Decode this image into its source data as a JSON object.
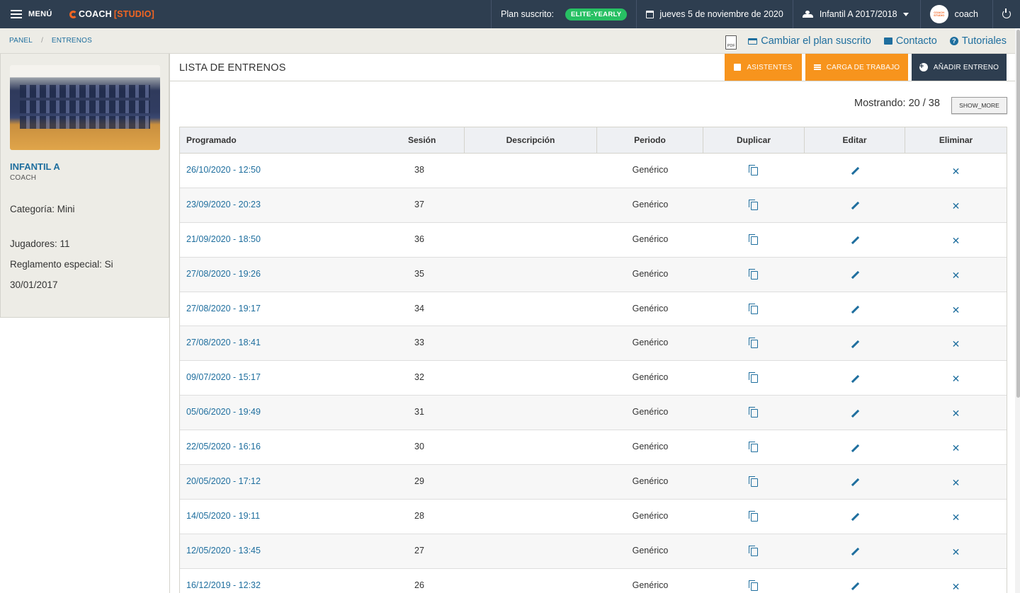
{
  "topbar": {
    "menu_label": "MENÚ",
    "logo_text": "COACH",
    "logo_studio": "[STUDIO]",
    "plan_label": "Plan suscrito:",
    "plan_badge": "ELITE-YEARLY",
    "date": "jueves 5 de noviembre de 2020",
    "team_selector": "Infantil A 2017/2018",
    "user_name": "coach",
    "avatar_text": "COACH STUDIO"
  },
  "breadcrumb": {
    "items": [
      "PANEL",
      "ENTRENOS"
    ],
    "separator": "/"
  },
  "crumb_actions": {
    "pdf_label": "PDF",
    "change_plan": "Cambiar el plan suscrito",
    "contact": "Contacto",
    "tutorials": "Tutoriales"
  },
  "sidebar": {
    "team_name": "INFANTIL A",
    "role": "COACH",
    "category": "Categoría: Mini",
    "players": "Jugadores: 11",
    "special_rules": "Reglamento especial: Si",
    "date": "30/01/2017"
  },
  "panel": {
    "title": "LISTA DE ENTRENOS",
    "btn_attendees": "ASISTENTES",
    "btn_workload": "CARGA DE TRABAJO",
    "btn_add": "AÑADIR ENTRENO",
    "showing": "Mostrando: 20 / 38",
    "show_more": "SHOW_MORE"
  },
  "table": {
    "headers": [
      "Programado",
      "Sesión",
      "Descripción",
      "Periodo",
      "Duplicar",
      "Editar",
      "Eliminar"
    ],
    "rows": [
      {
        "date": "26/10/2020 - 12:50",
        "session": "38",
        "description": "",
        "period": "Genérico"
      },
      {
        "date": "23/09/2020 - 20:23",
        "session": "37",
        "description": "",
        "period": "Genérico"
      },
      {
        "date": "21/09/2020 - 18:50",
        "session": "36",
        "description": "",
        "period": "Genérico"
      },
      {
        "date": "27/08/2020 - 19:26",
        "session": "35",
        "description": "",
        "period": "Genérico"
      },
      {
        "date": "27/08/2020 - 19:17",
        "session": "34",
        "description": "",
        "period": "Genérico"
      },
      {
        "date": "27/08/2020 - 18:41",
        "session": "33",
        "description": "",
        "period": "Genérico"
      },
      {
        "date": "09/07/2020 - 15:17",
        "session": "32",
        "description": "",
        "period": "Genérico"
      },
      {
        "date": "05/06/2020 - 19:49",
        "session": "31",
        "description": "",
        "period": "Genérico"
      },
      {
        "date": "22/05/2020 - 16:16",
        "session": "30",
        "description": "",
        "period": "Genérico"
      },
      {
        "date": "20/05/2020 - 17:12",
        "session": "29",
        "description": "",
        "period": "Genérico"
      },
      {
        "date": "14/05/2020 - 19:11",
        "session": "28",
        "description": "",
        "period": "Genérico"
      },
      {
        "date": "12/05/2020 - 13:45",
        "session": "27",
        "description": "",
        "period": "Genérico"
      },
      {
        "date": "16/12/2019 - 12:32",
        "session": "26",
        "description": "",
        "period": "Genérico"
      }
    ]
  },
  "colors": {
    "topbar": "#2e3e50",
    "accent": "#1e6e9e",
    "orange": "#f7941d",
    "badge_green": "#27c063",
    "brand_orange": "#f26522"
  }
}
